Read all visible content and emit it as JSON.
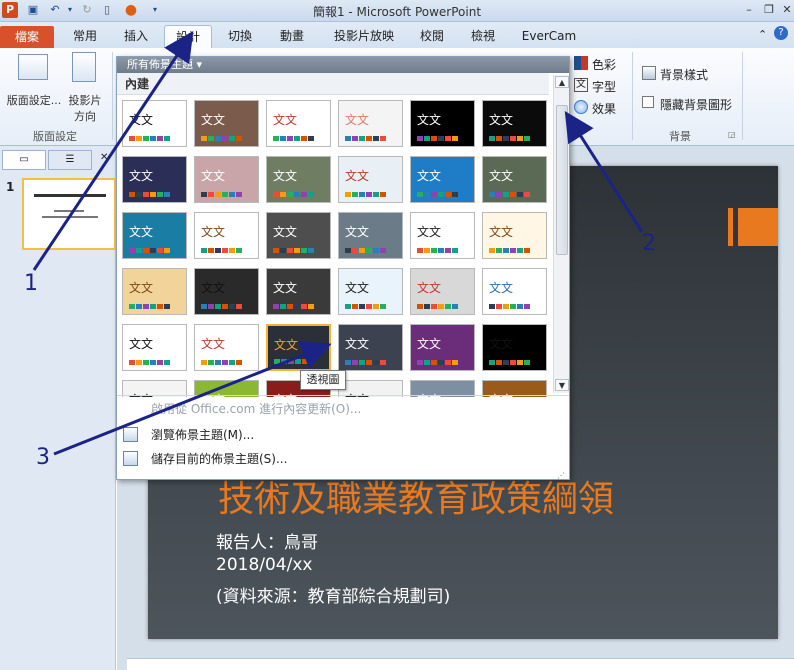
{
  "app": {
    "window_title": "簡報1 - Microsoft PowerPoint"
  },
  "tabs": [
    {
      "label": "檔案"
    },
    {
      "label": "常用"
    },
    {
      "label": "插入"
    },
    {
      "label": "設計"
    },
    {
      "label": "切換"
    },
    {
      "label": "動畫"
    },
    {
      "label": "投影片放映"
    },
    {
      "label": "校閱"
    },
    {
      "label": "檢視"
    },
    {
      "label": "EverCam"
    }
  ],
  "ribbon": {
    "page_setup_label": "版面設定...",
    "orientation_label_1": "投影片",
    "orientation_label_2": "方向",
    "group_page_setup": "版面設定",
    "colors_label": "色彩",
    "fonts_label": "字型",
    "effects_label": "效果",
    "background_styles_label": "背景樣式",
    "hide_bg_label": "隱藏背景圖形",
    "group_background": "背景"
  },
  "gallery": {
    "header": "所有佈景主題",
    "section": "內建",
    "theme_text": "文文",
    "menu_items": [
      {
        "label": "啟用從 Office.com 進行內容更新(O)...",
        "disabled": true
      },
      {
        "label": "瀏覽佈景主題(M)..."
      },
      {
        "label": "儲存目前的佈景主題(S)..."
      }
    ],
    "tooltip": "透視圖"
  },
  "slides_panel": {
    "slide_number": "1"
  },
  "slide": {
    "title": "技術及職業教育政策綱領",
    "presenter": "報告人：鳥哥",
    "date": "2018/04/xx",
    "source": "(資料來源：教育部綜合規劃司)"
  },
  "annotations": {
    "label_1": "1",
    "label_2": "2",
    "label_3": "3"
  },
  "colors": {
    "accent_orange": "#e8791f",
    "annotation_blue": "#1c2387",
    "file_tab": "#d9512c",
    "selected_border": "#f3b23b"
  }
}
